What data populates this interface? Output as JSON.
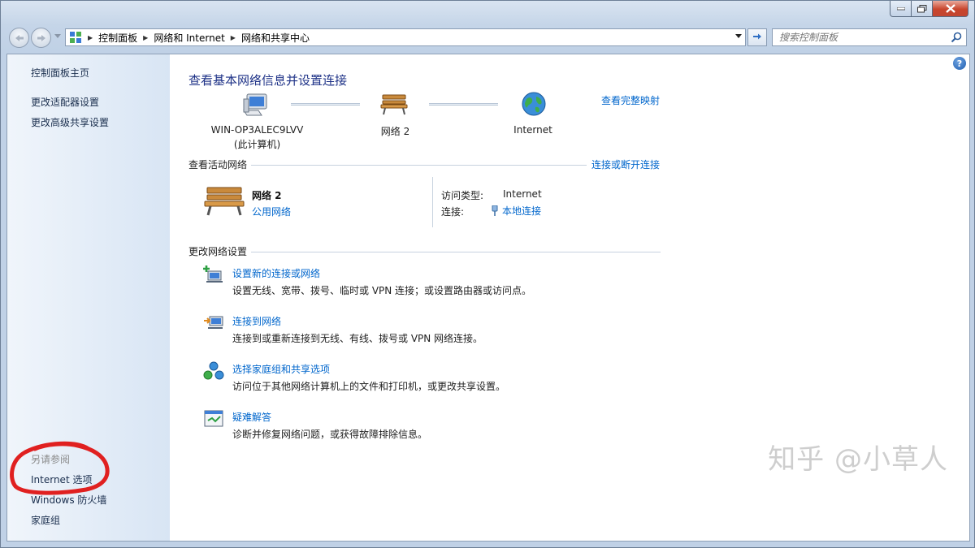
{
  "window": {
    "colors": {
      "accent": "#1e3287",
      "link": "#0066cc",
      "close": "#c8452c",
      "annotation": "#e02020"
    }
  },
  "address_bar": {
    "breadcrumbs": [
      "控制面板",
      "网络和 Internet",
      "网络和共享中心"
    ],
    "search_placeholder": "搜索控制面板"
  },
  "sidebar": {
    "links": [
      "控制面板主页",
      "更改适配器设置",
      "更改高级共享设置"
    ],
    "see_also_title": "另请参阅",
    "see_also": [
      "Internet 选项",
      "Windows 防火墙",
      "家庭组"
    ]
  },
  "main": {
    "title": "查看基本网络信息并设置连接",
    "full_map_link": "查看完整映射",
    "map": {
      "computer_name": "WIN-OP3ALEC9LVV",
      "computer_sub": "(此计算机)",
      "network_name": "网络  2",
      "internet": "Internet"
    },
    "active": {
      "heading": "查看活动网络",
      "connect_link": "连接或断开连接",
      "network_name": "网络  2",
      "network_type": "公用网络",
      "access_label": "访问类型:",
      "access_value": "Internet",
      "connection_label": "连接:",
      "connection_value": "本地连接"
    },
    "change": {
      "heading": "更改网络设置",
      "tasks": [
        {
          "title": "设置新的连接或网络",
          "desc": "设置无线、宽带、拨号、临时或 VPN 连接；或设置路由器或访问点。",
          "icon": "new-connection-icon"
        },
        {
          "title": "连接到网络",
          "desc": "连接到或重新连接到无线、有线、拨号或 VPN 网络连接。",
          "icon": "connect-network-icon"
        },
        {
          "title": "选择家庭组和共享选项",
          "desc": "访问位于其他网络计算机上的文件和打印机，或更改共享设置。",
          "icon": "homegroup-icon"
        },
        {
          "title": "疑难解答",
          "desc": "诊断并修复网络问题，或获得故障排除信息。",
          "icon": "troubleshoot-icon"
        }
      ]
    }
  },
  "watermark": "知乎 @小草人"
}
